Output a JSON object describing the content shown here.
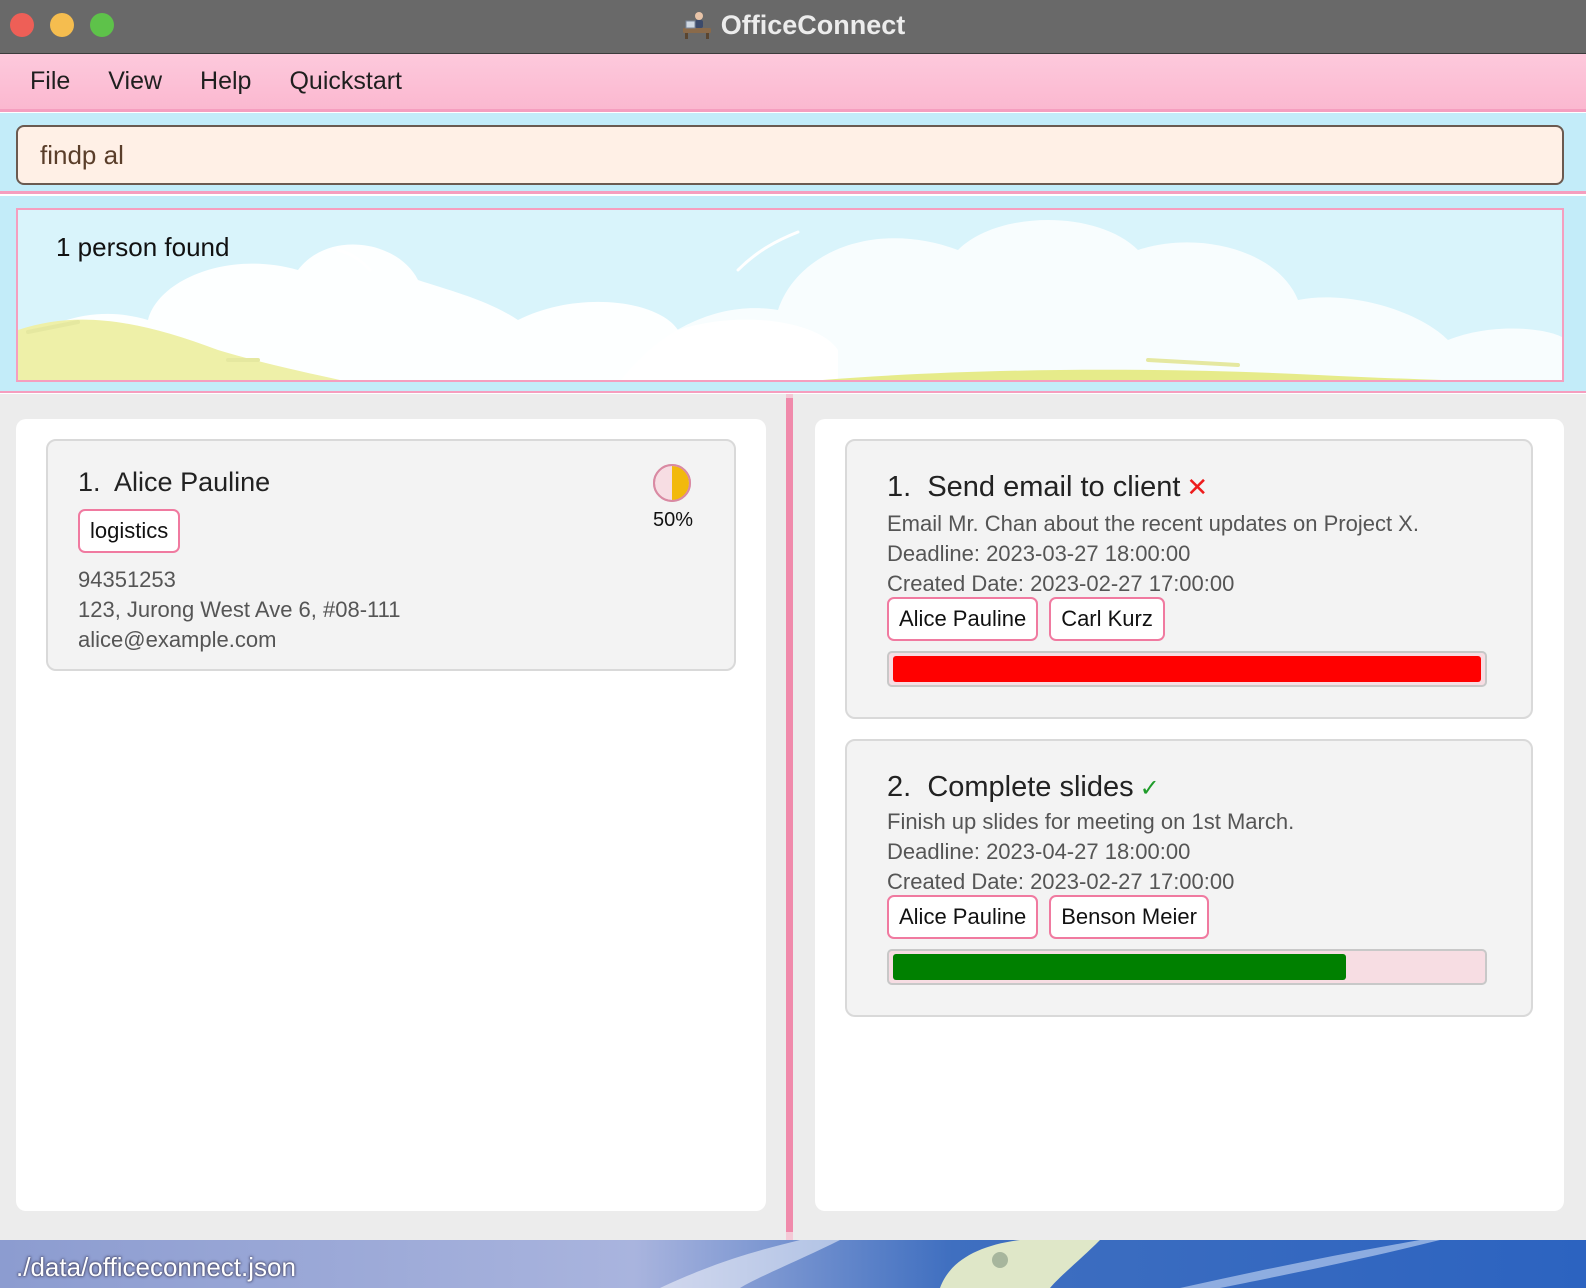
{
  "window": {
    "title": "OfficeConnect",
    "app_icon": "office-desk-icon"
  },
  "menu": {
    "items": [
      "File",
      "View",
      "Help",
      "Quickstart"
    ]
  },
  "command": {
    "value": "findp al"
  },
  "result": {
    "message": "1 person found"
  },
  "persons": [
    {
      "index": "1.",
      "name": "Alice Pauline",
      "tags": [
        "logistics"
      ],
      "phone": "94351253",
      "address": "123, Jurong West Ave 6, #08-111",
      "email": "alice@example.com",
      "progress_label": "50%",
      "progress_fraction": 0.5,
      "progress_color": "#f2b90c"
    }
  ],
  "tasks": [
    {
      "index": "1.",
      "title": "Send email to client",
      "status_icon": "cross-icon",
      "status_symbol": "✕",
      "description": "Email Mr. Chan about the recent updates on Project X.",
      "deadline": "Deadline: 2023-03-27 18:00:00",
      "created": "Created Date: 2023-02-27 17:00:00",
      "assignees": [
        "Alice Pauline",
        "Carl Kurz"
      ],
      "progress_fraction": 1.0,
      "progress_color": "#ff0000"
    },
    {
      "index": "2.",
      "title": "Complete slides",
      "status_icon": "check-icon",
      "status_symbol": "✓",
      "description": "Finish up slides for meeting on 1st March.",
      "deadline": "Deadline: 2023-04-27 18:00:00",
      "created": "Created Date: 2023-02-27 17:00:00",
      "assignees": [
        "Alice Pauline",
        "Benson Meier"
      ],
      "progress_fraction": 0.77,
      "progress_color": "#008000"
    }
  ],
  "status_bar": {
    "file_path": "./data/officeconnect.json"
  },
  "colors": {
    "accent_pink": "#f59ebf",
    "menu_bg": "#fbb8d0",
    "command_bg": "#fff0e6",
    "sky_bg": "#c3ecf9"
  }
}
